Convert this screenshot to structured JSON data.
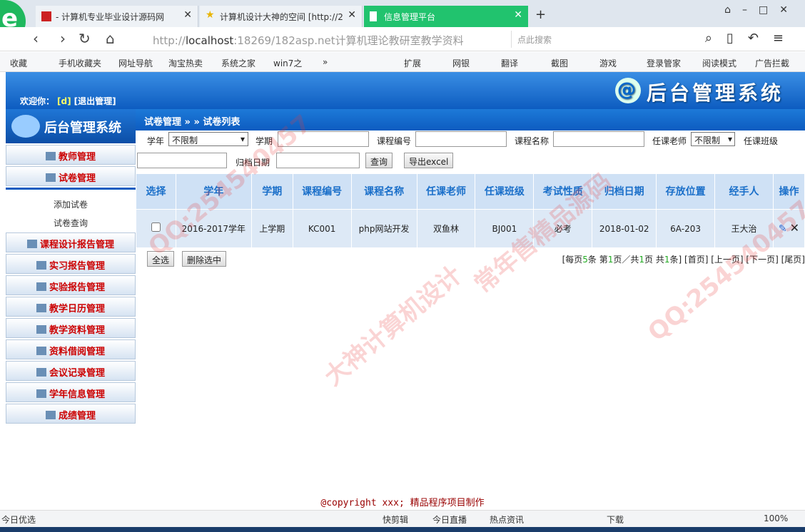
{
  "browser": {
    "tabs": [
      {
        "label": "- 计算机专业毕业设计源码网"
      },
      {
        "label": "计算机设计大神的空间 [http://2"
      },
      {
        "label": "信息管理平台"
      }
    ],
    "url_host": "http://",
    "url_main": "localhost",
    "url_rest": ":18269/182asp.net计算机理论教研室教学资料",
    "search_placeholder": "点此搜索",
    "bookmarks": [
      "收藏",
      "手机收藏夹",
      "网址导航",
      "淘宝热卖",
      "系统之家",
      "win7之",
      "»",
      "扩展",
      "网银",
      "翻译",
      "截图",
      "游戏",
      "登录管家",
      "阅读模式",
      "广告拦截"
    ]
  },
  "header": {
    "welcome": "欢迎你：",
    "user": "[d]",
    "logout": "[退出管理]",
    "title": "后台管理系统",
    "logo_char": "@"
  },
  "sidebar": {
    "title": "后台管理系统",
    "menus": [
      {
        "label": "教师管理"
      },
      {
        "label": "试卷管理"
      }
    ],
    "subitems": [
      {
        "label": "添加试卷"
      },
      {
        "label": "试卷查询"
      }
    ],
    "menus2": [
      {
        "label": "课程设计报告管理"
      },
      {
        "label": "实习报告管理"
      },
      {
        "label": "实验报告管理"
      },
      {
        "label": "教学日历管理"
      },
      {
        "label": "教学资料管理"
      },
      {
        "label": "资料借阅管理"
      },
      {
        "label": "会议记录管理"
      },
      {
        "label": "学年信息管理"
      },
      {
        "label": "成绩管理"
      }
    ]
  },
  "crumb": "试卷管理 » » 试卷列表",
  "filters": {
    "year_label": "学年",
    "year_value": "不限制",
    "term_label": "学期",
    "code_label": "课程编号",
    "name_label": "课程名称",
    "teacher_label": "任课老师",
    "teacher_value": "不限制",
    "class_label": "任课班级",
    "archive_label": "归档日期",
    "query": "查询",
    "export": "导出excel"
  },
  "table": {
    "headers": [
      "选择",
      "学年",
      "学期",
      "课程编号",
      "课程名称",
      "任课老师",
      "任课班级",
      "考试性质",
      "归档日期",
      "存放位置",
      "经手人",
      "操作"
    ],
    "rows": [
      [
        "",
        "2016-2017学年",
        "上学期",
        "KC001",
        "php网站开发",
        "双鱼林",
        "BJ001",
        "必考",
        "2018-01-02",
        "6A-203",
        "王大治",
        ""
      ]
    ]
  },
  "actions": {
    "select_all": "全选",
    "delete": "删除选中"
  },
  "pager": {
    "a": "[每页",
    "per": "5",
    "b": "条 第",
    "cur": "1",
    "c": "页／共",
    "total": "1",
    "d": "页 共",
    "count": "1",
    "e": "条]",
    "first": "[首页]",
    "prev": "[上一页]",
    "next": "[下一页]",
    "last": "[尾页]"
  },
  "copyright": "@copyright xxx; 精品程序项目制作",
  "status": {
    "left": "今日优选",
    "items": [
      "快剪辑",
      "今日直播",
      "热点资讯",
      "下载",
      "100%"
    ]
  },
  "watermark": [
    "QQ:254540457",
    "大神计算机设计",
    "常年售精品源码",
    "QQ:254540457"
  ]
}
